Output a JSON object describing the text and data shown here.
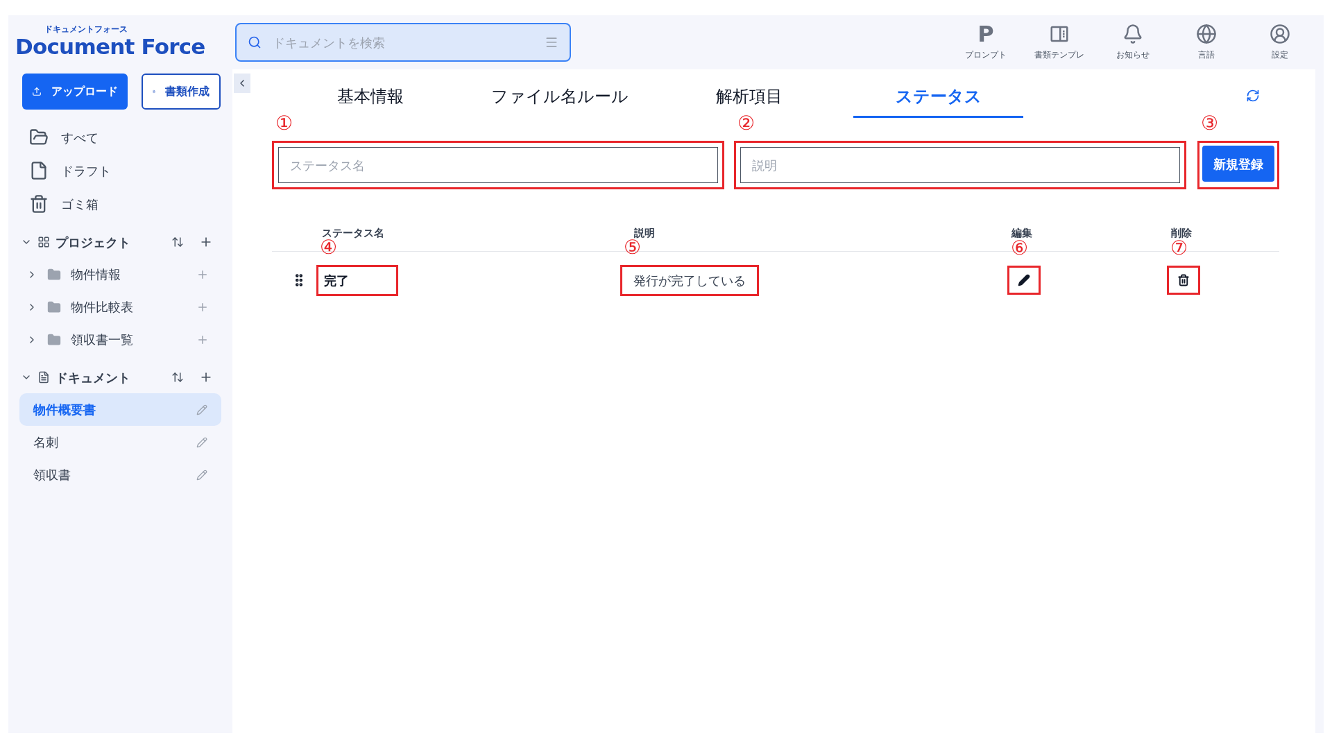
{
  "logo": {
    "kana": "ドキュメントフォース",
    "name": "Document Force"
  },
  "search": {
    "placeholder": "ドキュメントを検索"
  },
  "top_nav": [
    {
      "label": "プロンプト",
      "kind": "prompt",
      "glyph": "P"
    },
    {
      "label": "書類テンプレ",
      "kind": "template"
    },
    {
      "label": "お知らせ",
      "kind": "bell"
    },
    {
      "label": "言語",
      "kind": "globe"
    },
    {
      "label": "設定",
      "kind": "user"
    }
  ],
  "actions": [
    {
      "label": "アップロード",
      "kind": "primary"
    },
    {
      "label": "書類作成",
      "kind": "outline"
    }
  ],
  "nav": [
    {
      "label": "すべて",
      "kind": "folder"
    },
    {
      "label": "ドラフト",
      "kind": "file"
    },
    {
      "label": "ゴミ箱",
      "kind": "trash"
    }
  ],
  "projects": {
    "title": "プロジェクト",
    "expanded": true,
    "items": [
      {
        "label": "物件情報",
        "expanded": false
      },
      {
        "label": "物件比較表",
        "expanded": false
      },
      {
        "label": "領収書一覧",
        "expanded": false
      }
    ]
  },
  "documents": {
    "title": "ドキュメント",
    "expanded": true,
    "items": [
      {
        "label": "物件概要書",
        "selected": true
      },
      {
        "label": "名刺",
        "selected": false
      },
      {
        "label": "領収書",
        "selected": false
      }
    ]
  },
  "tabs": [
    {
      "label": "基本情報",
      "selected": false
    },
    {
      "label": "ファイル名ルール",
      "selected": false
    },
    {
      "label": "解析項目",
      "selected": false
    },
    {
      "label": "ステータス",
      "selected": true
    }
  ],
  "form": {
    "name_field": {
      "placeholder": "ステータス名",
      "marker": "①"
    },
    "description_field": {
      "placeholder": "説明",
      "marker": "②"
    },
    "submit": {
      "label": "新規登録",
      "marker": "③"
    }
  },
  "table": {
    "columns": [
      "ステータス名",
      "説明",
      "編集",
      "削除"
    ],
    "rows": [
      {
        "name": "完了",
        "description": "発行が完了している",
        "markers": [
          "④",
          "⑤",
          "⑥",
          "⑦"
        ]
      }
    ]
  }
}
